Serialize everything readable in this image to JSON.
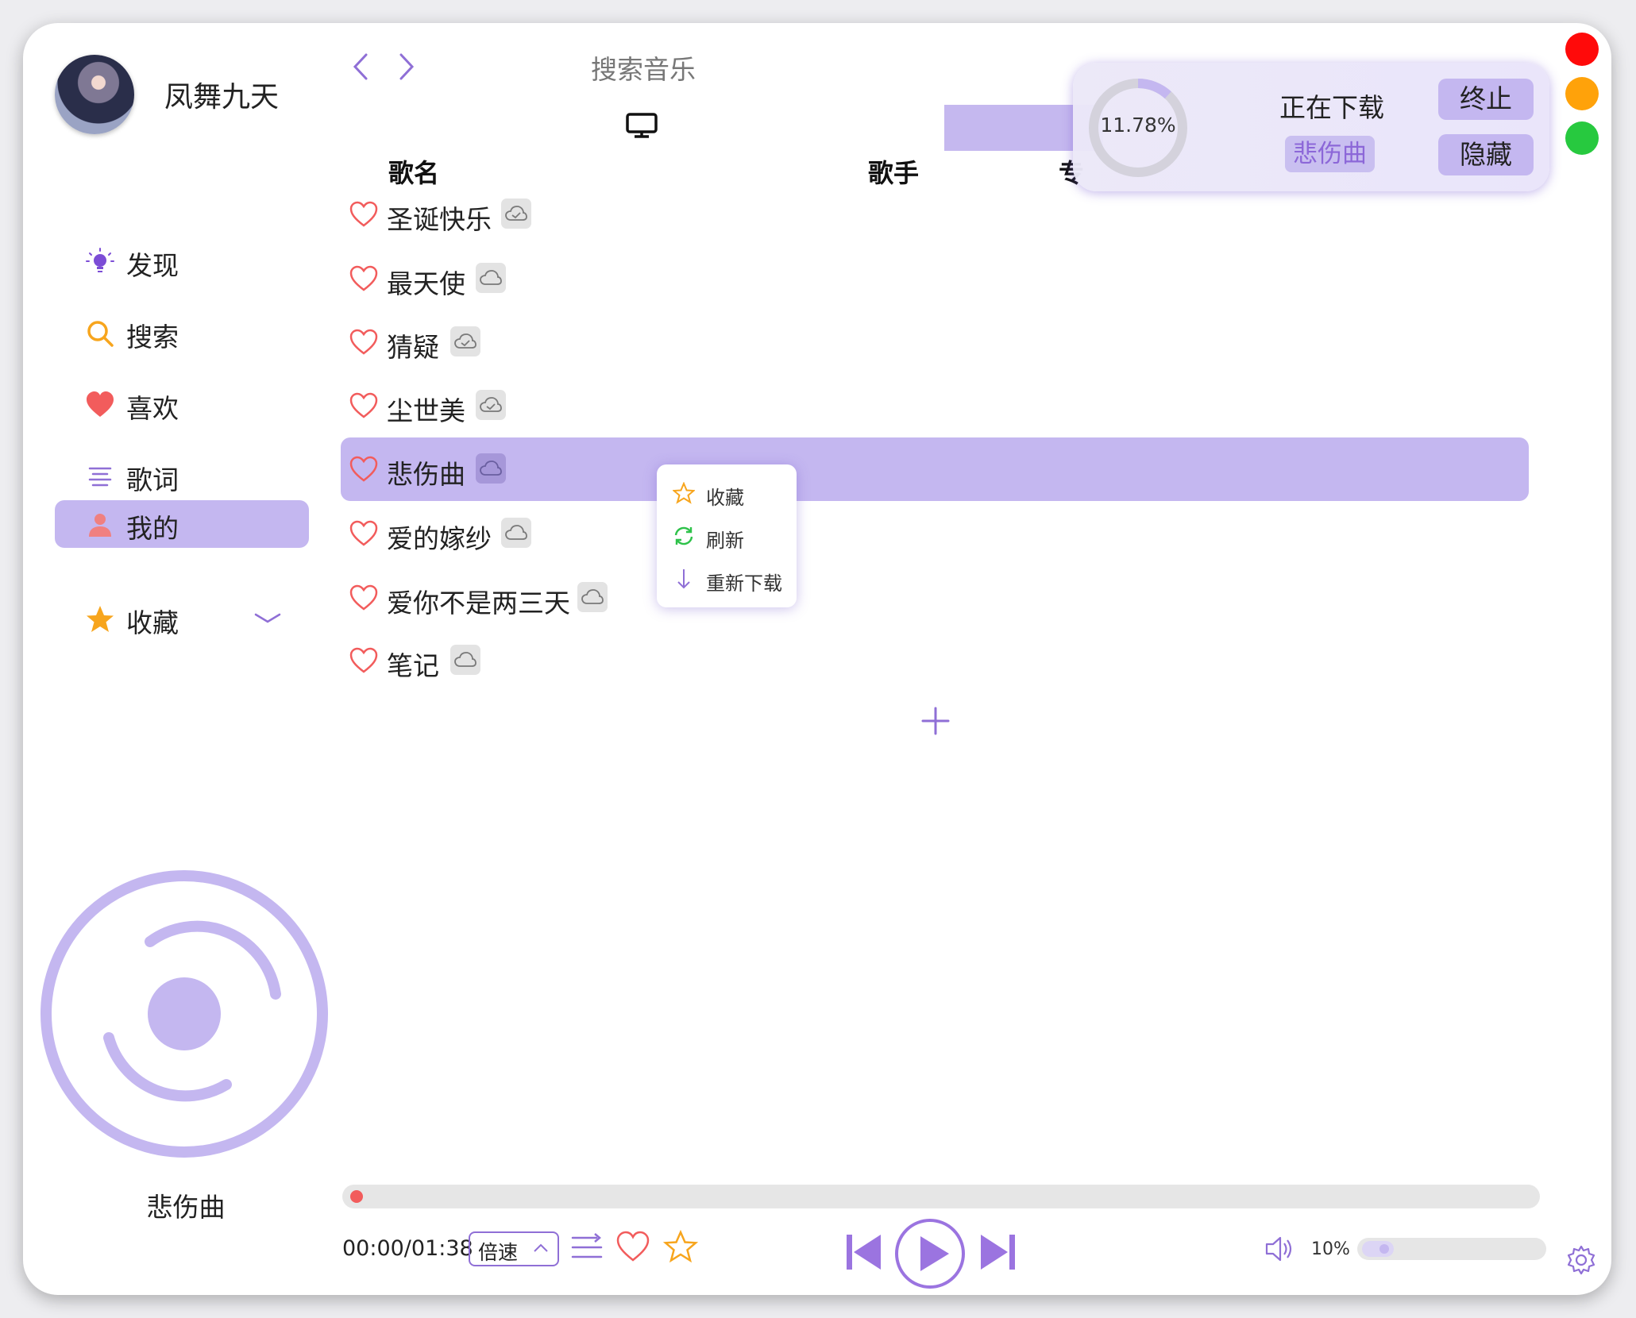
{
  "colors": {
    "accent": "#c4b7f0",
    "accent_dark": "#8f6fd6",
    "heart": "#f25c5c",
    "star": "#f7a51d",
    "green": "#2ec24a"
  },
  "user": {
    "name": "凤舞九天"
  },
  "sidebar": {
    "items": [
      {
        "label": "发现",
        "icon": "lightbulb-icon"
      },
      {
        "label": "搜索",
        "icon": "search-icon"
      },
      {
        "label": "喜欢",
        "icon": "heart-icon"
      },
      {
        "label": "歌词",
        "icon": "lyrics-lines-icon"
      },
      {
        "label": "我的",
        "icon": "user-icon",
        "active": true
      },
      {
        "label": "收藏",
        "icon": "star-icon",
        "expandable": true
      }
    ]
  },
  "header": {
    "search_placeholder": "搜索音乐",
    "columns": {
      "name": "歌名",
      "artist": "歌手",
      "album_partial": "专"
    }
  },
  "songs": [
    {
      "title": "圣诞快乐",
      "cloud": "cloud-check-icon"
    },
    {
      "title": "最天使",
      "cloud": "cloud-icon"
    },
    {
      "title": "猜疑",
      "cloud": "cloud-check-icon"
    },
    {
      "title": "尘世美",
      "cloud": "cloud-check-icon"
    },
    {
      "title": "悲伤曲",
      "cloud": "cloud-icon",
      "selected": true
    },
    {
      "title": "爱的嫁纱",
      "cloud": "cloud-icon"
    },
    {
      "title": "爱你不是两三天",
      "cloud": "cloud-icon"
    },
    {
      "title": "笔记",
      "cloud": "cloud-icon"
    }
  ],
  "context_menu": {
    "items": [
      {
        "label": "收藏",
        "icon": "star-outline-icon"
      },
      {
        "label": "刷新",
        "icon": "refresh-icon"
      },
      {
        "label": "重新下载",
        "icon": "arrow-down-icon"
      }
    ]
  },
  "download": {
    "progress_text": "11.78%",
    "progress": 0.1178,
    "status": "正在下载",
    "song": "悲伤曲",
    "stop_label": "终止",
    "hide_label": "隐藏"
  },
  "now_playing": {
    "title": "悲伤曲"
  },
  "player": {
    "time": "00:00/01:38",
    "progress": 0.0,
    "speed_label": "倍速",
    "volume_text": "10%",
    "volume": 0.1
  }
}
